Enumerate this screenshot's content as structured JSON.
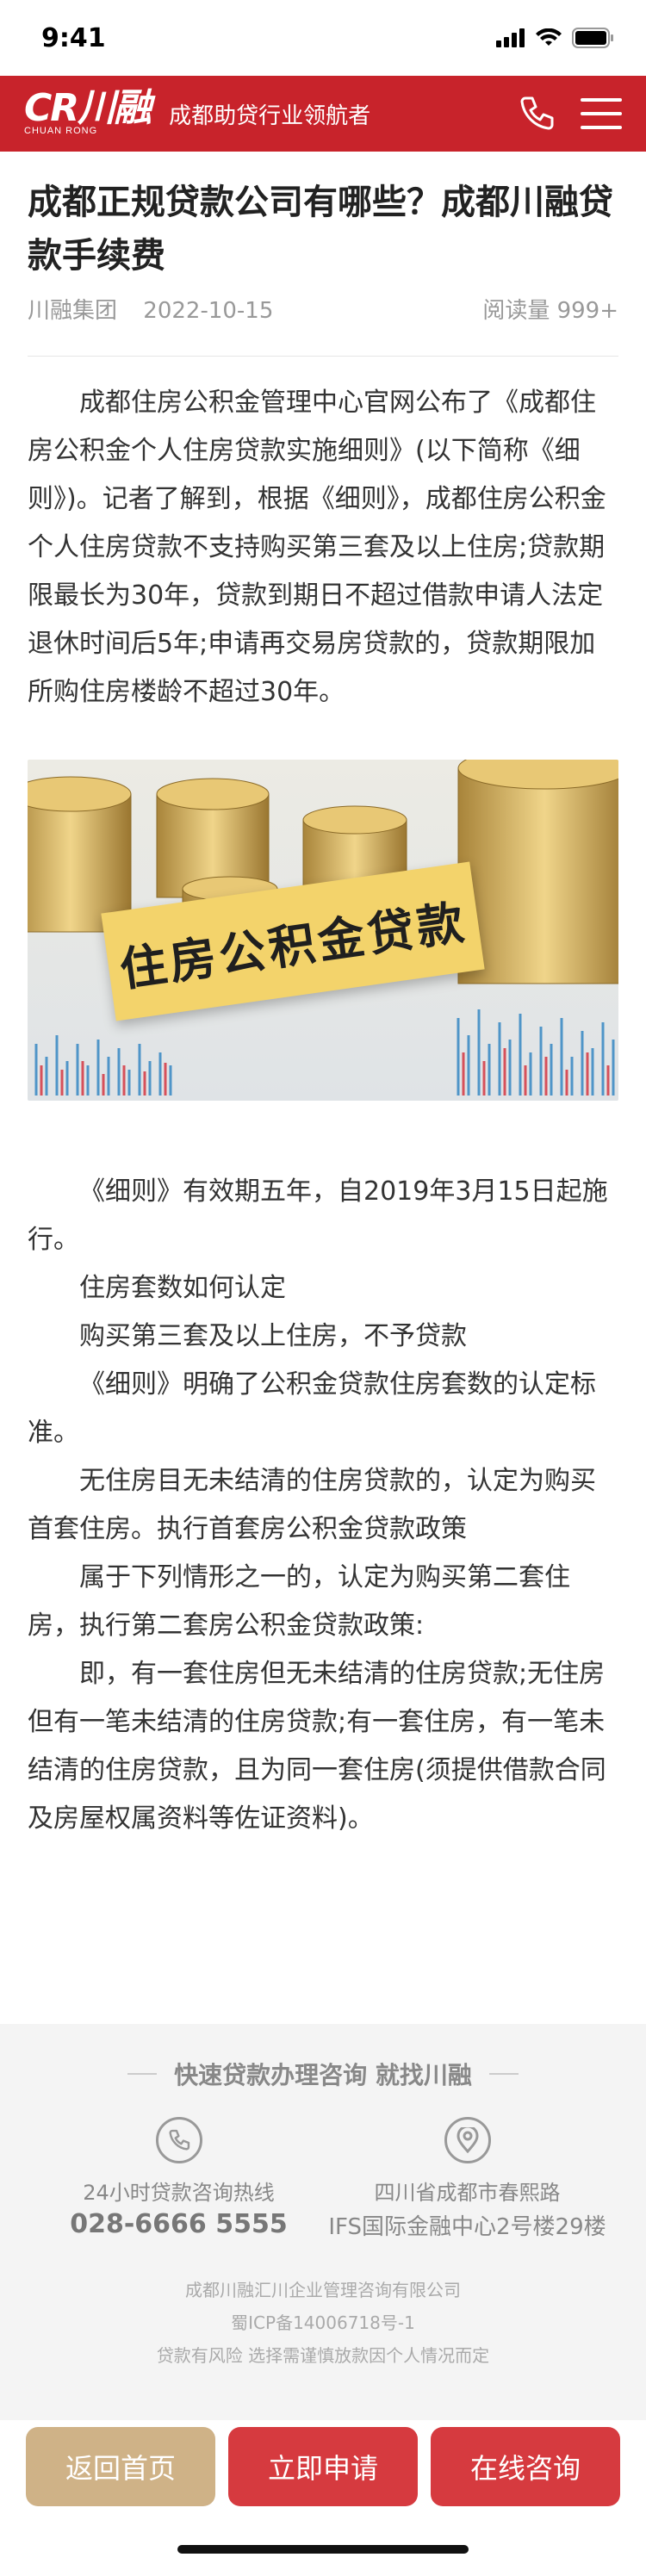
{
  "status_bar": {
    "time": "9:41"
  },
  "header": {
    "logo_text": "CR川融",
    "logo_sub": "CHUAN RONG",
    "tagline": "成都助贷行业领航者"
  },
  "article": {
    "title": "成都正规贷款公司有哪些？成都川融贷款手续费",
    "author": "川融集团",
    "date": "2022-10-15",
    "reads": "阅读量 999+",
    "intro": "成都住房公积金管理中心官网公布了《成都住房公积金个人住房贷款实施细则》(以下简称《细则》)。记者了解到，根据《细则》，成都住房公积金个人住房贷款不支持购买第三套及以上住房;贷款期限最长为30年，贷款到期日不超过借款申请人法定退休时间后5年;申请再交易房贷款的，贷款期限加所购住房楼龄不超过30年。",
    "image_caption": "住房公积金贷款",
    "paragraphs": [
      "《细则》有效期五年，自2019年3月15日起施行。",
      "住房套数如何认定",
      "购买第三套及以上住房，不予贷款",
      "《细则》明确了公积金贷款住房套数的认定标准。",
      "无住房目无未结清的住房贷款的，认定为购买首套住房。执行首套房公积金贷款政策",
      "属于下列情形之一的，认定为购买第二套住房，执行第二套房公积金贷款政策:",
      "即，有一套住房但无未结清的住房贷款;无住房但有一笔未结清的住房贷款;有一套住房，有一笔未结清的住房贷款，且为同一套住房(须提供借款合同及房屋权属资料等佐证资料)。"
    ]
  },
  "footer": {
    "title": "快速贷款办理咨询 就找川融",
    "hotline_label": "24小时贷款咨询热线",
    "hotline": "028-6666 5555",
    "address_line1": "四川省成都市春熙路",
    "address_line2": "IFS国际金融中心2号楼29楼",
    "company": "成都川融汇川企业管理咨询有限公司",
    "icp": "蜀ICP备14006718号-1",
    "risk": "贷款有风险  选择需谨慎放款因个人情况而定"
  },
  "bottom_bar": {
    "home": "返回首页",
    "apply": "立即申请",
    "consult": "在线咨询"
  },
  "colors": {
    "brand_red": "#c8232b",
    "button_gold": "#cfb287",
    "button_red": "#d63a3f"
  }
}
